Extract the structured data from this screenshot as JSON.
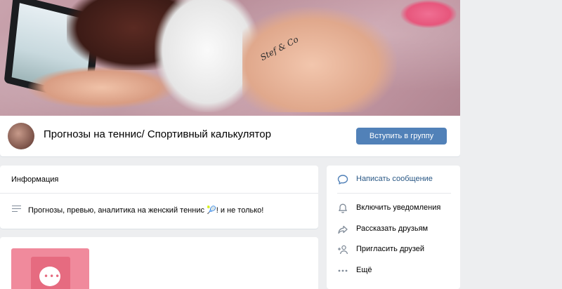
{
  "cover": {
    "tattoo_text": "Stef & Co"
  },
  "header": {
    "title": "Прогнозы на теннис/ Спортивный калькулятор",
    "join_label": "Вступить в группу"
  },
  "info": {
    "title": "Информация",
    "description": "Прогнозы, превью, аналитика на женский теннис 🎾! и не только!"
  },
  "actions": {
    "items": [
      {
        "label": "Написать сообщение",
        "icon": "message-icon",
        "primary": true
      },
      {
        "label": "Включить уведомления",
        "icon": "bell-icon"
      },
      {
        "label": "Рассказать друзьям",
        "icon": "share-icon"
      },
      {
        "label": "Пригласить друзей",
        "icon": "add-user-icon"
      },
      {
        "label": "Ещё",
        "icon": "more-icon"
      }
    ]
  },
  "colors": {
    "accent": "#5181b8",
    "link": "#2a5885",
    "background": "#edeef0",
    "icon": "#818c99"
  }
}
